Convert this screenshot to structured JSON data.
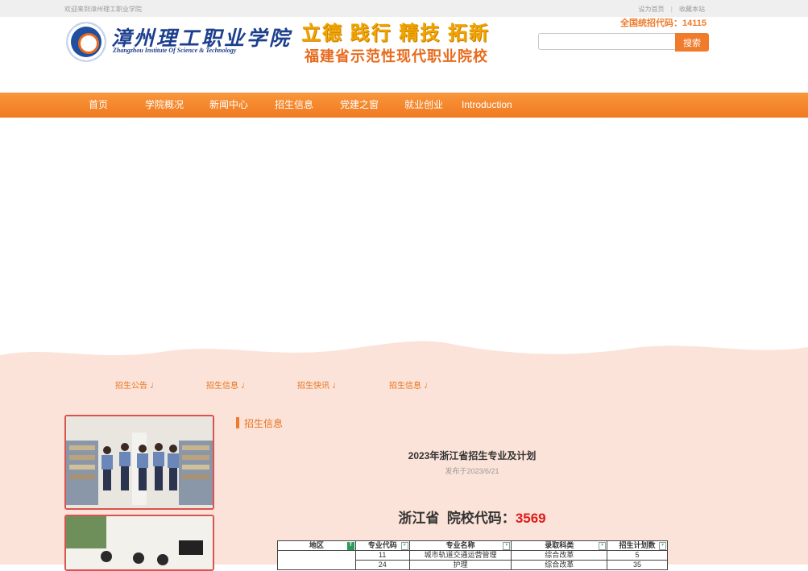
{
  "topbar": {
    "welcome": "欢迎来到漳州理工职业学院",
    "set_home": "设为首页",
    "separator": "|",
    "bookmark": "收藏本站"
  },
  "header": {
    "logo_cn": "漳州理工职业学院",
    "logo_en": "Zhangzhou Institute Of Science & Technology",
    "slogan_line1": "立德 践行 精技 拓新",
    "slogan_line2": "福建省示范性现代职业院校",
    "enrollment_code": "全国统招代码：14115",
    "search_placeholder": "",
    "search_button": "搜索"
  },
  "nav": {
    "items": [
      "首页",
      "学院概况",
      "新闻中心",
      "招生信息",
      "党建之窗",
      "就业创业",
      "Introduction"
    ]
  },
  "subnav": {
    "items": [
      "招生公告",
      "招生信息",
      "招生快讯",
      "招生信息"
    ],
    "icon": "music-note-icon"
  },
  "main": {
    "section_title": "招生信息",
    "article_title": "2023年浙江省招生专业及计划",
    "article_date": "发布于2023/6/21",
    "province": "浙江省",
    "code_label": "院校代码：",
    "code_value": "3569"
  },
  "table": {
    "headers": [
      "地区",
      "专业代码",
      "专业名称",
      "录取科类",
      "招生计划数"
    ],
    "rows": [
      [
        "",
        "11",
        "城市轨道交通运营管理",
        "综合改革",
        "5"
      ],
      [
        "",
        "24",
        "护理",
        "综合改革",
        "35"
      ]
    ]
  },
  "colors": {
    "accent": "#f07b2a",
    "nav_gradient_top": "#f9963b",
    "nav_gradient_bottom": "#f07a21",
    "pink_bg": "#fbe3d9",
    "code_red": "#e01a1a",
    "logo_blue": "#1c3f8e"
  }
}
